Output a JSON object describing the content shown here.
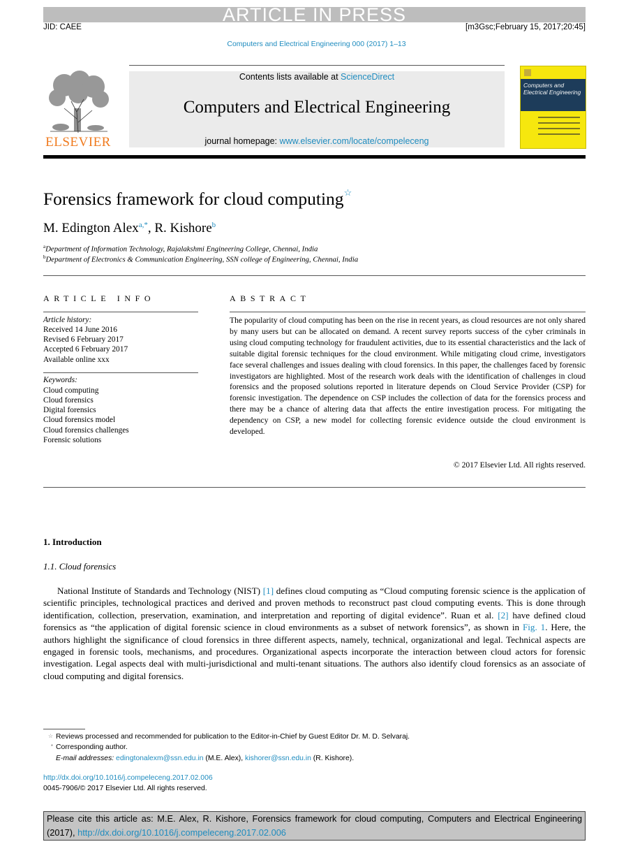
{
  "banner": {
    "text": "ARTICLE IN PRESS"
  },
  "header": {
    "jid": "JID: CAEE",
    "stamp": "[m3Gsc;February 15, 2017;20:45]",
    "journal_ref": "Computers and Electrical Engineering 000 (2017) 1–13"
  },
  "masthead": {
    "publisher_logo_text": "ELSEVIER",
    "contents_prefix": "Contents lists available at ",
    "contents_link": "ScienceDirect",
    "journal_title": "Computers and Electrical Engineering",
    "homepage_prefix": "journal homepage: ",
    "homepage_link": "www.elsevier.com/locate/compeleceng",
    "cover_title_line1": "Computers and",
    "cover_title_line2": "Electrical Engineering"
  },
  "article": {
    "title": "Forensics framework for cloud computing",
    "title_note_mark": "☆",
    "authors": [
      {
        "name": "M. Edington Alex",
        "marks": "a,*"
      },
      {
        "name": "R. Kishore",
        "marks": "b"
      }
    ],
    "author_separator": ", ",
    "affiliations": [
      {
        "mark": "a",
        "text": "Department of Information Technology, Rajalakshmi Engineering College, Chennai, India"
      },
      {
        "mark": "b",
        "text": "Department of Electronics & Communication Engineering, SSN college of Engineering, Chennai, India"
      }
    ]
  },
  "article_info": {
    "heading": "ARTICLE INFO",
    "history_label": "Article history:",
    "history": [
      "Received 14 June 2016",
      "Revised 6 February 2017",
      "Accepted 6 February 2017",
      "Available online xxx"
    ],
    "keywords_label": "Keywords:",
    "keywords": [
      "Cloud computing",
      "Cloud forensics",
      "Digital forensics",
      "Cloud forensics model",
      "Cloud forensics challenges",
      "Forensic solutions"
    ]
  },
  "abstract": {
    "heading": "ABSTRACT",
    "text": "The popularity of cloud computing has been on the rise in recent years, as cloud resources are not only shared by many users but can be allocated on demand. A recent survey reports success of the cyber criminals in using cloud computing technology for fraudulent activities, due to its essential characteristics and the lack of suitable digital forensic techniques for the cloud environment. While mitigating cloud crime, investigators face several challenges and issues dealing with cloud forensics. In this paper, the challenges faced by forensic investigators are highlighted. Most of the research work deals with the identification of challenges in cloud forensics and the proposed solutions reported in literature depends on Cloud Service Provider (CSP) for forensic investigation. The dependence on CSP includes the collection of data for the forensics process and there may be a chance of altering data that affects the entire investigation process. For mitigating the dependency on CSP, a new model for collecting forensic evidence outside the cloud environment is developed.",
    "copyright": "© 2017 Elsevier Ltd. All rights reserved."
  },
  "body": {
    "section_heading": "1.  Introduction",
    "subsection_heading": "1.1.  Cloud forensics",
    "paragraph": [
      {
        "t": "National Institute of Standards and Technology (NIST) "
      },
      {
        "t": "[1]",
        "link": true
      },
      {
        "t": " defines cloud computing as “Cloud computing forensic science is the application of scientific principles, technological practices and derived and proven methods to reconstruct past cloud computing events. This is done through identification, collection, preservation, examination, and interpretation and reporting of digital evidence”. Ruan et al. "
      },
      {
        "t": "[2]",
        "link": true
      },
      {
        "t": " have defined cloud forensics as “the application of digital forensic science in cloud environments as a subset of network forensics”, as shown in "
      },
      {
        "t": "Fig. 1",
        "link": true
      },
      {
        "t": ". Here, the authors highlight the significance of cloud forensics in three different aspects, namely, technical, organizational and legal. Technical aspects are engaged in forensic tools, mechanisms, and procedures. Organizational aspects incorporate the interaction between cloud actors for forensic investigation. Legal aspects deal with multi-jurisdictional and multi-tenant situations. The authors also identify cloud forensics as an associate of cloud computing and digital forensics."
      }
    ]
  },
  "footnotes": {
    "note1_mark": "☆",
    "note1": "Reviews processed and recommended for publication to the Editor-in-Chief by Guest Editor Dr. M. D. Selvaraj.",
    "note2_mark": "*",
    "note2": "Corresponding author.",
    "email_label": "E-mail addresses: ",
    "email1": "edingtonalexm@ssn.edu.in",
    "email1_owner": " (M.E. Alex), ",
    "email2": "kishorer@ssn.edu.in",
    "email2_owner": " (R. Kishore).",
    "doi": "http://dx.doi.org/10.1016/j.compeleceng.2017.02.006",
    "issn": "0045-7906/© 2017 Elsevier Ltd. All rights reserved."
  },
  "cite": {
    "prefix": "Please cite this article as: M.E. Alex, R. Kishore, Forensics framework for cloud computing, Computers and Electrical Engineering (2017), ",
    "link": "http://dx.doi.org/10.1016/j.compeleceng.2017.02.006"
  },
  "colors": {
    "link": "#1f8cbf",
    "banner_bg": "#bdbdbd",
    "masthead_bg": "#ebebeb",
    "elsevier_orange": "#f07b1f",
    "cover_yellow": "#f6e70e",
    "cover_band": "#1d3c5a",
    "cite_bg": "#c4c4c4"
  }
}
